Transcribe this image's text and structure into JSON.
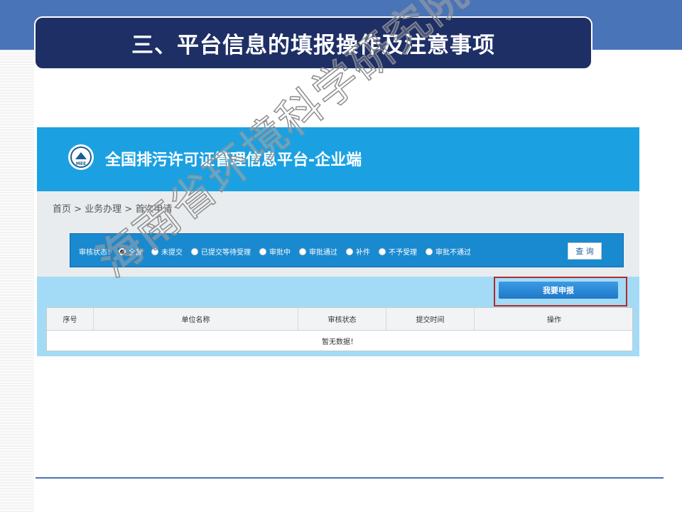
{
  "slide": {
    "title": "三、平台信息的填报操作及注意事项",
    "watermark": "海南省环境科学研究院制"
  },
  "platform": {
    "logo_text": "MEE",
    "title": "全国排污许可证管理信息平台-企业端",
    "breadcrumb": "首页 > 业务办理 > 首次申请",
    "filter": {
      "label": "审核状态：",
      "options": [
        {
          "label": "全部",
          "selected": true
        },
        {
          "label": "未提交",
          "selected": false
        },
        {
          "label": "已提交等待受理",
          "selected": false
        },
        {
          "label": "审批中",
          "selected": false
        },
        {
          "label": "审批通过",
          "selected": false
        },
        {
          "label": "补件",
          "selected": false
        },
        {
          "label": "不予受理",
          "selected": false
        },
        {
          "label": "审批不通过",
          "selected": false
        }
      ],
      "query_button": "查 询"
    },
    "apply_button": "我要申报",
    "table": {
      "headers": [
        "序号",
        "单位名称",
        "审核状态",
        "提交时间",
        "操作"
      ],
      "empty_text": "暂无数据！"
    }
  },
  "colors": {
    "band": "#4a74b8",
    "title_bg": "#1e2f66",
    "platform_header": "#1ba1e2",
    "filter_bg": "#1989d0",
    "highlight": "#b52a2a"
  }
}
